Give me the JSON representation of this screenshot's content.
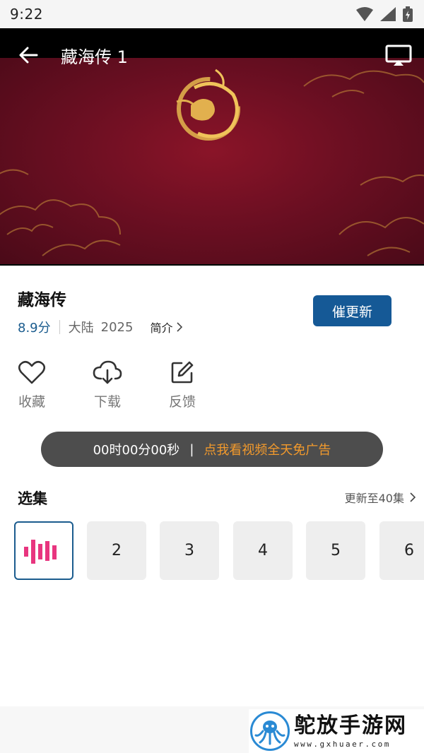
{
  "status_bar": {
    "time": "9:22"
  },
  "player": {
    "title": "藏海传 1"
  },
  "show": {
    "title": "藏海传",
    "rating": "8.9分",
    "region": "大陆",
    "year": "2025",
    "intro_label": "简介"
  },
  "update_button": {
    "label": "催更新"
  },
  "actions": [
    {
      "label": "收藏",
      "icon": "heart-icon"
    },
    {
      "label": "下载",
      "icon": "cloud-download-icon"
    },
    {
      "label": "反馈",
      "icon": "edit-icon"
    }
  ],
  "ad_banner": {
    "countdown": "00时00分00秒",
    "separator": "|",
    "cta": "点我看视频全天免广告"
  },
  "episodes": {
    "title": "选集",
    "more": "更新至40集",
    "items": [
      {
        "label": "",
        "playing": true
      },
      {
        "label": "2"
      },
      {
        "label": "3"
      },
      {
        "label": "4"
      },
      {
        "label": "5"
      },
      {
        "label": "6"
      }
    ]
  },
  "watermark": {
    "title": "鸵放手游网",
    "url": "www.gxhuaer.com"
  },
  "colors": {
    "accent": "#155996",
    "rating": "#1b5c8e",
    "ad_cta": "#f39a2c",
    "playing_bars": "#e8357f"
  }
}
